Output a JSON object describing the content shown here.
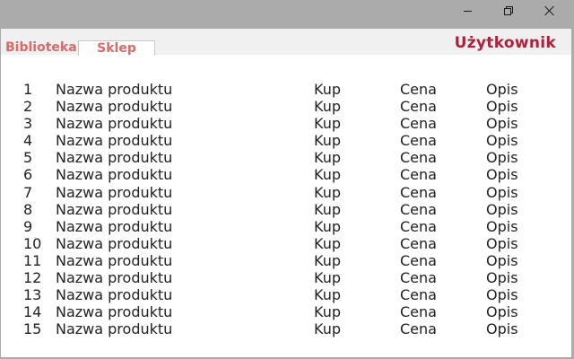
{
  "window_controls": {
    "minimize_icon": "minimize-icon",
    "maximize_icon": "restore-icon",
    "close_icon": "close-icon"
  },
  "tabs": [
    {
      "label": "Biblioteka",
      "active": false
    },
    {
      "label": "Sklep",
      "active": true
    }
  ],
  "user": {
    "label": "Użytkownik"
  },
  "colors": {
    "tab_text": "#d96a6a",
    "user_text": "#b0203a",
    "chrome": "#ababab"
  },
  "products": [
    {
      "num": "1",
      "name": "Nazwa produktu",
      "buy": "Kup",
      "price": "Cena",
      "desc": "Opis"
    },
    {
      "num": "2",
      "name": "Nazwa produktu",
      "buy": "Kup",
      "price": "Cena",
      "desc": "Opis"
    },
    {
      "num": "3",
      "name": "Nazwa produktu",
      "buy": "Kup",
      "price": "Cena",
      "desc": "Opis"
    },
    {
      "num": "4",
      "name": "Nazwa produktu",
      "buy": "Kup",
      "price": "Cena",
      "desc": "Opis"
    },
    {
      "num": "5",
      "name": "Nazwa produktu",
      "buy": "Kup",
      "price": "Cena",
      "desc": "Opis"
    },
    {
      "num": "6",
      "name": "Nazwa produktu",
      "buy": "Kup",
      "price": "Cena",
      "desc": "Opis"
    },
    {
      "num": "7",
      "name": "Nazwa produktu",
      "buy": "Kup",
      "price": "Cena",
      "desc": "Opis"
    },
    {
      "num": "8",
      "name": "Nazwa produktu",
      "buy": "Kup",
      "price": "Cena",
      "desc": "Opis"
    },
    {
      "num": "9",
      "name": "Nazwa produktu",
      "buy": "Kup",
      "price": "Cena",
      "desc": "Opis"
    },
    {
      "num": "10",
      "name": "Nazwa produktu",
      "buy": "Kup",
      "price": "Cena",
      "desc": "Opis"
    },
    {
      "num": "11",
      "name": "Nazwa produktu",
      "buy": "Kup",
      "price": "Cena",
      "desc": "Opis"
    },
    {
      "num": "12",
      "name": "Nazwa produktu",
      "buy": "Kup",
      "price": "Cena",
      "desc": "Opis"
    },
    {
      "num": "13",
      "name": "Nazwa produktu",
      "buy": "Kup",
      "price": "Cena",
      "desc": "Opis"
    },
    {
      "num": "14",
      "name": "Nazwa produktu",
      "buy": "Kup",
      "price": "Cena",
      "desc": "Opis"
    },
    {
      "num": "15",
      "name": "Nazwa produktu",
      "buy": "Kup",
      "price": "Cena",
      "desc": "Opis"
    }
  ]
}
